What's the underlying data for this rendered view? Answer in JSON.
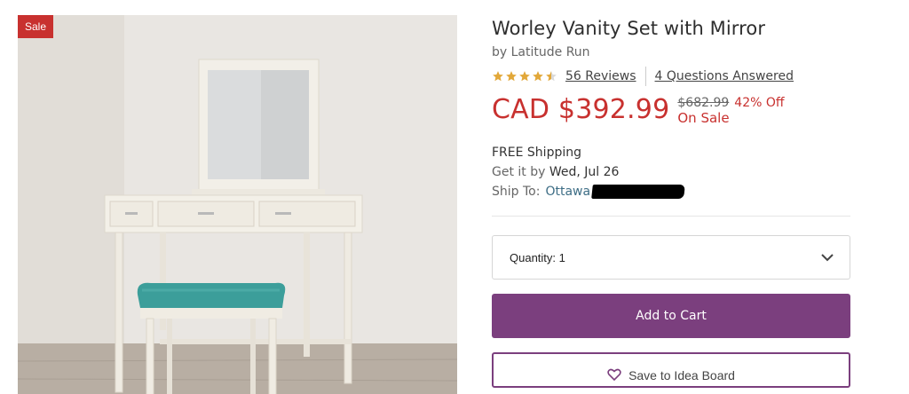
{
  "badge": {
    "label": "Sale",
    "color": "#c8312f"
  },
  "product": {
    "title": "Worley Vanity Set with Mirror",
    "brand": "by Latitude Run",
    "rating": 4.5,
    "rating_max": 5,
    "reviews_label": "56 Reviews",
    "qa_label": "4 Questions Answered"
  },
  "price": {
    "current": "CAD $392.99",
    "was": "$682.99",
    "discount": "42% Off",
    "status": "On Sale",
    "accent": "#c8312f"
  },
  "shipping": {
    "free": "FREE Shipping",
    "get_it_prefix": "Get it by ",
    "get_it_date": "Wed, Jul 26",
    "ship_to_label": "Ship To:",
    "city": "Ottawa"
  },
  "quantity": {
    "label": "Quantity: 1",
    "icon": "chevron-down-icon"
  },
  "actions": {
    "add_to_cart": "Add to Cart",
    "add_to_list": "Save to Idea Board",
    "brand_color": "#7b3f7e"
  }
}
